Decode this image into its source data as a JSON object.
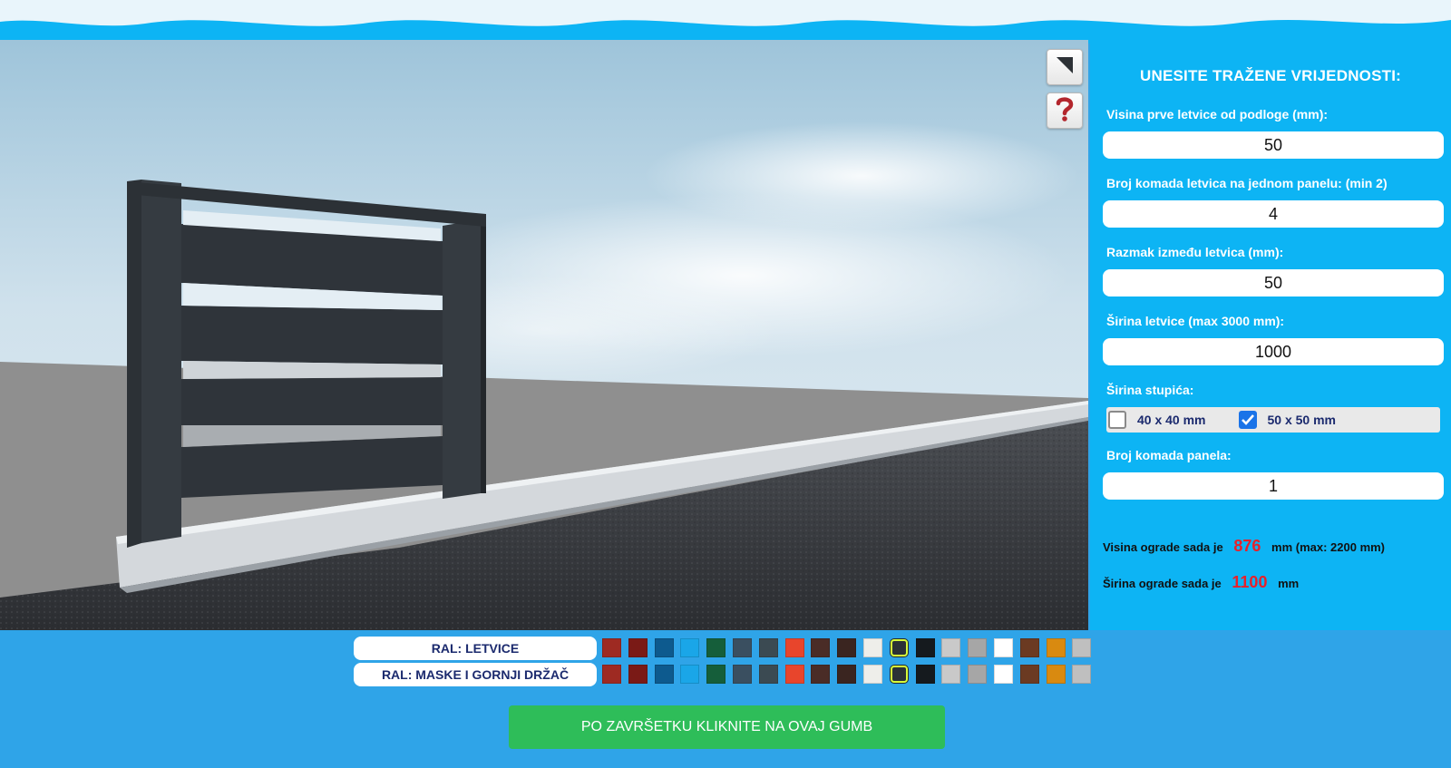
{
  "viewport": {
    "fullscreen_icon": "fullscreen-corner-icon",
    "help_icon": "question-mark-icon",
    "fence_color": "#2c3136"
  },
  "panel": {
    "title": "UNESITE TRAŽENE VRIJEDNOSTI:",
    "fields": [
      {
        "label": "Visina prve letvice od podloge (mm):",
        "value": "50"
      },
      {
        "label": "Broj komada letvica na jednom panelu: (min 2)",
        "value": "4"
      },
      {
        "label": "Razmak između letvica (mm):",
        "value": "50"
      },
      {
        "label": "Širina letvice (max 3000 mm):",
        "value": "1000"
      }
    ],
    "post_width": {
      "label": "Širina stupića:",
      "options": [
        {
          "label": "40 x 40 mm",
          "checked": false
        },
        {
          "label": "50 x 50 mm",
          "checked": true
        }
      ]
    },
    "panel_count": {
      "label": "Broj komada panela:",
      "value": "1"
    },
    "summary": {
      "height_prefix": "Visina ograde sada je",
      "height_value": "876",
      "height_suffix": "mm (max: 2200 mm)",
      "width_prefix": "Širina ograde sada je",
      "width_value": "1100",
      "width_suffix": "mm"
    }
  },
  "ral": {
    "rows": [
      {
        "label": "RAL: LETVICE"
      },
      {
        "label": "RAL: MASKE I GORNJI DRŽAČ"
      }
    ],
    "swatches": [
      "#9e2a22",
      "#7a1a16",
      "#0d5a8e",
      "#1aa6e8",
      "#155e3a",
      "#3a4f60",
      "#3b4a52",
      "#e8452c",
      "#4a2c26",
      "#3a2520",
      "#eeeeea",
      "#2c3136",
      "#151a1e",
      "#c9c9c9",
      "#a6a6a6",
      "#ffffff",
      "#6b3a22",
      "#d98a10",
      "#bfbfbf"
    ],
    "selected_index": 11
  },
  "cta_label": "PO ZAVRŠETKU KLIKNITE NA OVAJ GUMB"
}
